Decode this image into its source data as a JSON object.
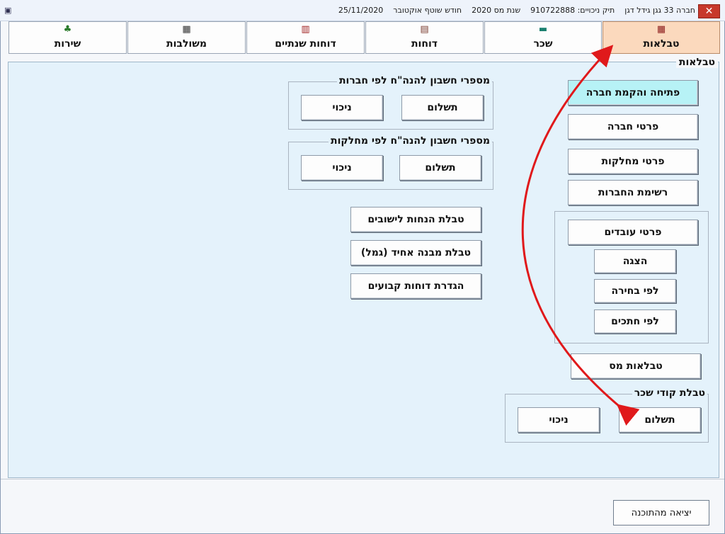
{
  "window": {
    "title_parts": [
      "חברה 33 גגן גידל דגן",
      "תיק ניכויים: 910722888",
      "שנת מס 2020",
      "חודש שוטף אוקטובר",
      "25/11/2020"
    ],
    "close_label": "✕"
  },
  "tabs": [
    {
      "label": "טבלאות",
      "icon": "table-icon",
      "active": true
    },
    {
      "label": "שכר",
      "icon": "cash-register-icon",
      "active": false
    },
    {
      "label": "דוחות",
      "icon": "report-icon",
      "active": false
    },
    {
      "label": "דוחות שנתיים",
      "icon": "annual-report-icon",
      "active": false
    },
    {
      "label": "משולבות",
      "icon": "combined-icon",
      "active": false
    },
    {
      "label": "שירות",
      "icon": "service-icon",
      "active": false
    }
  ],
  "panel": {
    "label": "טבלאות",
    "right_buttons": {
      "open_company": "פתיחה והקמת חברה",
      "company_details": "פרטי חברה",
      "department_details": "פרטי מחלקות",
      "company_list": "רשימת החברות"
    },
    "employees_group": {
      "main": "פרטי עובדים",
      "show": "הצגה",
      "by_selection": "לפי בחירה",
      "by_sections": "לפי חתכים"
    },
    "tax_tables": "טבלאות מס",
    "wage_codes_group": {
      "title": "טבלת קודי שכר",
      "payment": "תשלום",
      "deduction": "ניכוי"
    },
    "accounts_by_company": {
      "title": "מספרי חשבון להנה\"ח לפי חברות",
      "payment": "תשלום",
      "deduction": "ניכוי"
    },
    "accounts_by_department": {
      "title": "מספרי חשבון להנה\"ח לפי מחלקות",
      "payment": "תשלום",
      "deduction": "ניכוי"
    },
    "middle_buttons": {
      "settlement_discounts": "טבלת הנחות לישובים",
      "uniform_structure": "טבלת מבנה אחיד (גמל)",
      "fixed_reports": "הגדרת דוחות קבועים"
    }
  },
  "exit_label": "יציאה מהתוכנה",
  "colors": {
    "active_tab": "#fbd9bd",
    "panel_bg": "#e4f2fb",
    "highlight_button": "#b7f2f6",
    "arrow": "#e0191b"
  }
}
